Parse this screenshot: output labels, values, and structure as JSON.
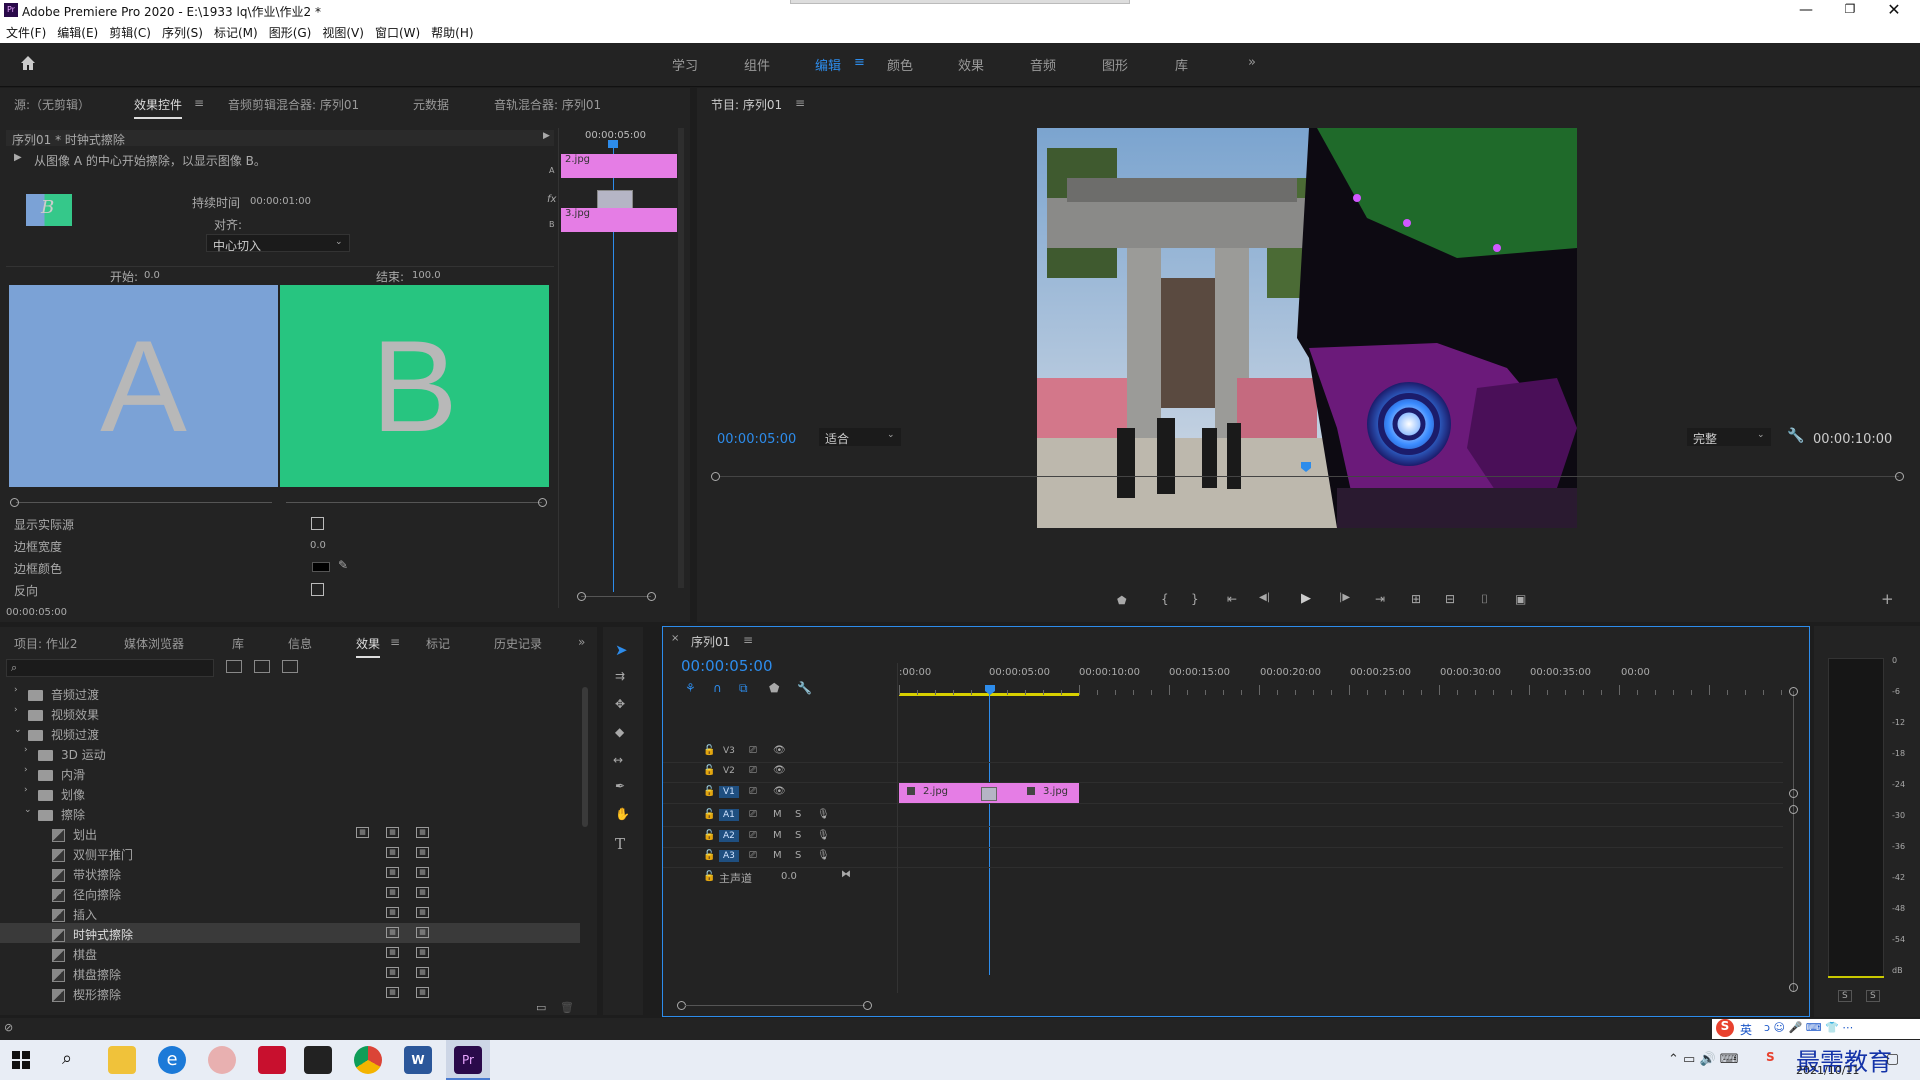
{
  "app": {
    "title": "Adobe Premiere Pro 2020 - E:\\1933 lq\\作业\\作业2 *",
    "menus": [
      "文件(F)",
      "编辑(E)",
      "剪辑(C)",
      "序列(S)",
      "标记(M)",
      "图形(G)",
      "视图(V)",
      "窗口(W)",
      "帮助(H)"
    ]
  },
  "workspaces": [
    "学习",
    "组件",
    "编辑",
    "颜色",
    "效果",
    "音频",
    "图形",
    "库"
  ],
  "workspaces_active": "编辑",
  "source_panel": {
    "tabs": [
      "源:（无剪辑）",
      "效果控件",
      "音频剪辑混合器: 序列01",
      "元数据",
      "音轨混合器: 序列01"
    ],
    "active_tab": "效果控件",
    "header": "序列01 * 时钟式擦除",
    "desc": "从图像 A 的中心开始擦除，以显示图像 B。",
    "mini_timecode": "00:00:05:00",
    "clip_a": "2.jpg",
    "clip_b": "3.jpg",
    "duration_label": "持续时间",
    "duration_value": "00:00:01:00",
    "align_label": "对齐:",
    "align_value": "中心切入",
    "start_label": "开始:",
    "start_value": "0.0",
    "end_label": "结束:",
    "end_value": "100.0",
    "letter_a": "A",
    "letter_b": "B",
    "show_actual": "显示实际源",
    "border_width": "边框宽度",
    "border_width_value": "0.0",
    "border_color": "边框颜色",
    "reverse": "反向",
    "bottom_timecode": "00:00:05:00"
  },
  "program": {
    "title": "节目: 序列01",
    "timecode": "00:00:05:00",
    "fit": "适合",
    "quality": "完整",
    "duration": "00:00:10:00"
  },
  "project_panel": {
    "tabs": [
      "项目: 作业2",
      "媒体浏览器",
      "库",
      "信息",
      "效果",
      "标记",
      "历史记录"
    ],
    "active_tab": "效果",
    "items": [
      {
        "label": "音频过渡",
        "level": 0,
        "open": false,
        "type": "folder"
      },
      {
        "label": "视频效果",
        "level": 0,
        "open": false,
        "type": "folder"
      },
      {
        "label": "视频过渡",
        "level": 0,
        "open": true,
        "type": "folder"
      },
      {
        "label": "3D 运动",
        "level": 1,
        "open": false,
        "type": "folder"
      },
      {
        "label": "内滑",
        "level": 1,
        "open": false,
        "type": "folder"
      },
      {
        "label": "划像",
        "level": 1,
        "open": false,
        "type": "folder"
      },
      {
        "label": "擦除",
        "level": 1,
        "open": true,
        "type": "folder"
      },
      {
        "label": "划出",
        "level": 2,
        "type": "effect",
        "badges": 3
      },
      {
        "label": "双侧平推门",
        "level": 2,
        "type": "effect",
        "badges": 2
      },
      {
        "label": "带状擦除",
        "level": 2,
        "type": "effect",
        "badges": 2
      },
      {
        "label": "径向擦除",
        "level": 2,
        "type": "effect",
        "badges": 2
      },
      {
        "label": "插入",
        "level": 2,
        "type": "effect",
        "badges": 2
      },
      {
        "label": "时钟式擦除",
        "level": 2,
        "type": "effect",
        "badges": 2,
        "selected": true
      },
      {
        "label": "棋盘",
        "level": 2,
        "type": "effect",
        "badges": 2
      },
      {
        "label": "棋盘擦除",
        "level": 2,
        "type": "effect",
        "badges": 2
      },
      {
        "label": "楔形擦除",
        "level": 2,
        "type": "effect",
        "badges": 2
      }
    ]
  },
  "timeline": {
    "title": "序列01",
    "timecode": "00:00:05:00",
    "ruler": [
      ":00:00",
      "00:00:05:00",
      "00:00:10:00",
      "00:00:15:00",
      "00:00:20:00",
      "00:00:25:00",
      "00:00:30:00",
      "00:00:35:00",
      "00:00"
    ],
    "video_tracks": [
      "V3",
      "V2",
      "V1"
    ],
    "audio_tracks": [
      "A1",
      "A2",
      "A3"
    ],
    "master": "主声道",
    "master_value": "0.0",
    "clip1": "2.jpg",
    "clip2": "3.jpg",
    "m": "M",
    "s": "S"
  },
  "meter": {
    "scale": [
      "0",
      "-6",
      "-12",
      "-18",
      "-24",
      "-30",
      "-36",
      "-42",
      "-48",
      "-54",
      "dB"
    ],
    "solo": [
      "S",
      "S"
    ]
  },
  "taskbar": {
    "date": "2021/10/11",
    "ime": "英",
    "watermark": "最需教育"
  }
}
